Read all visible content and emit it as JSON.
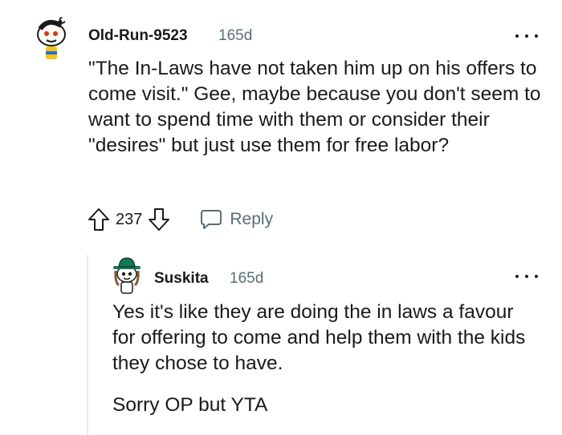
{
  "comment": {
    "author": "Old-Run-9523",
    "age": "165d",
    "avatar": "snoo-avatar-icon",
    "body": "\"The In-Laws have not taken him up on his offers to come visit.\" Gee, maybe because you don't seem to want to spend time with them or consider their \"desires\" but just use them for free labor?",
    "score": "237",
    "reply_label": "Reply",
    "more_icon": "more-options-icon"
  },
  "reply": {
    "author": "Suskita",
    "age": "165d",
    "avatar": "snoo-hat-avatar-icon",
    "paragraphs": [
      "Yes it's like they are doing the in laws a favour for offering to come and help them with the kids they chose to have.",
      "Sorry OP but YTA"
    ],
    "more_icon": "more-options-icon"
  },
  "colors": {
    "text": "#1a1a1b",
    "meta": "#576f76",
    "thread_line": "#e5ebee"
  }
}
